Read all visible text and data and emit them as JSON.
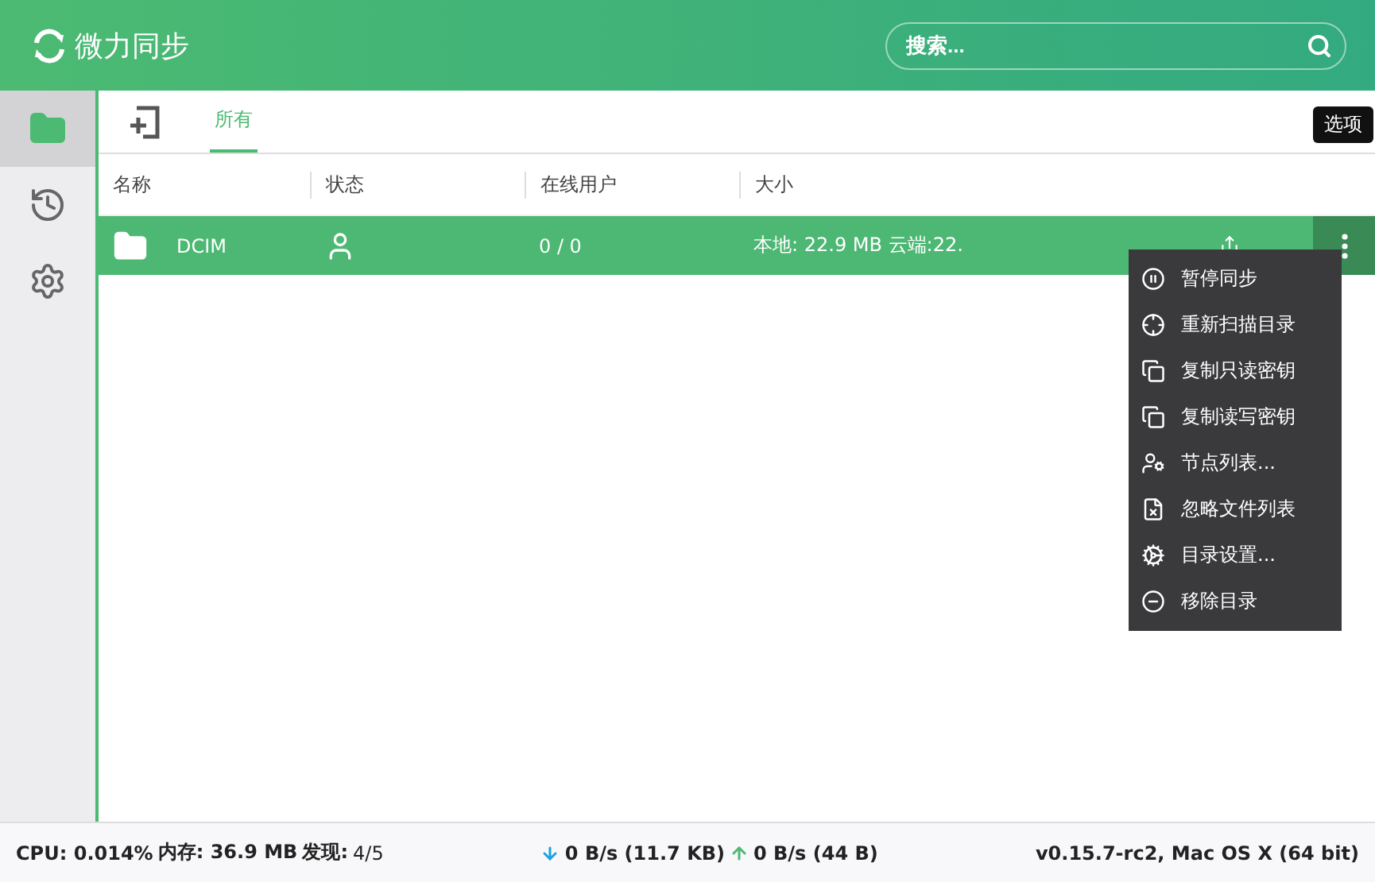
{
  "app": {
    "title": "微力同步"
  },
  "search": {
    "placeholder": "搜索..."
  },
  "sidebar": {
    "items": [
      {
        "kind": "folders",
        "selected": true
      },
      {
        "kind": "history",
        "selected": false
      },
      {
        "kind": "settings",
        "selected": false
      }
    ]
  },
  "tabs": [
    {
      "label": "所有",
      "selected": true
    }
  ],
  "table": {
    "columns": [
      "名称",
      "状态",
      "在线用户",
      "大小"
    ],
    "rows": [
      {
        "name": "DCIM",
        "online": "0 / 0",
        "size": "本地: 22.9 MB 云端:22.",
        "selected": true
      }
    ]
  },
  "tooltip": "选项",
  "menu": [
    {
      "kind": "pause",
      "label": "暂停同步"
    },
    {
      "kind": "rescan",
      "label": "重新扫描目录"
    },
    {
      "kind": "copy",
      "label": "复制只读密钥"
    },
    {
      "kind": "copy",
      "label": "复制读写密钥"
    },
    {
      "kind": "nodes",
      "label": "节点列表..."
    },
    {
      "kind": "ignore",
      "label": "忽略文件列表"
    },
    {
      "kind": "gear",
      "label": "目录设置..."
    },
    {
      "kind": "remove",
      "label": "移除目录"
    }
  ],
  "status_bar": {
    "cpu_label": "CPU:",
    "cpu": "0.014%",
    "mem_label": "内存:",
    "mem": "36.9 MB",
    "found_label": "发现:",
    "found": "4/5",
    "down": "0 B/s (11.7 KB)",
    "up": "0 B/s (44 B)",
    "version": "v0.15.7-rc2, Mac OS X (64 bit)"
  }
}
